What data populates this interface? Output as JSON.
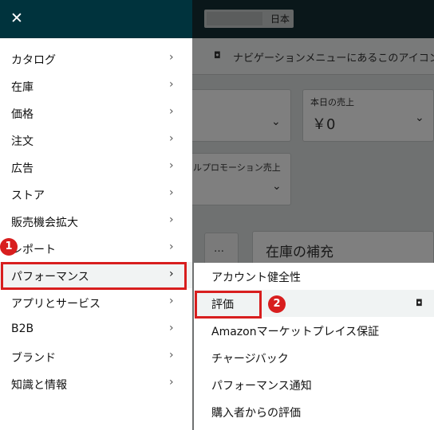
{
  "background": {
    "region_label": "日本",
    "info_text": "ナビゲーションメニューにあるこのアイコン",
    "info_icon": "pin-icon",
    "sales_today_label": "本日の売上",
    "sales_today_value": "￥0",
    "promo_sales_label": "ルプロモーション売上",
    "more_button_label": "…",
    "restock_title": "在庫の補充"
  },
  "drawer": {
    "close_icon": "close-icon",
    "items": [
      {
        "label": "カタログ"
      },
      {
        "label": "在庫"
      },
      {
        "label": "価格"
      },
      {
        "label": "注文"
      },
      {
        "label": "広告"
      },
      {
        "label": "ストア"
      },
      {
        "label": "販売機会拡大"
      },
      {
        "label": "レポート"
      },
      {
        "label": "パフォーマンス"
      },
      {
        "label": "アプリとサービス"
      },
      {
        "label": "B2B"
      },
      {
        "label": "ブランド"
      },
      {
        "label": "知識と情報"
      }
    ],
    "active_item": "パフォーマンス"
  },
  "submenu": {
    "items": [
      {
        "label": "アカウント健全性"
      },
      {
        "label": "評価"
      },
      {
        "label": "Amazonマーケットプレイス保証"
      },
      {
        "label": "チャージバック"
      },
      {
        "label": "パフォーマンス通知"
      },
      {
        "label": "購入者からの評価"
      }
    ],
    "hovered_item": "評価"
  },
  "annotations": {
    "step1": "1",
    "step2": "2",
    "color": "#d81e1e"
  }
}
